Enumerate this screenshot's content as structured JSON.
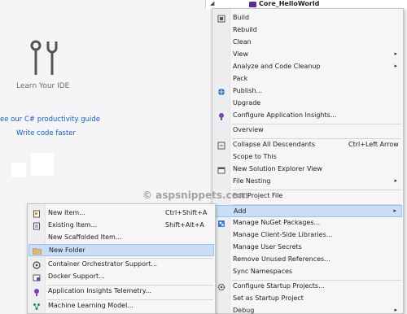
{
  "start_page": {
    "learn_label": "Learn Your IDE",
    "productivity_link": "ee our C# productivity guide",
    "write_faster_link": "Write code faster"
  },
  "solution_explorer": {
    "root_arrow": "◢",
    "root_label": "Core_HelloWorld"
  },
  "context_menu": {
    "items": [
      {
        "label": "Build",
        "icon": "build-icon"
      },
      {
        "label": "Rebuild"
      },
      {
        "label": "Clean"
      },
      {
        "label": "View",
        "arrow": "▸"
      },
      {
        "label": "Analyze and Code Cleanup",
        "arrow": "▸"
      },
      {
        "label": "Pack"
      },
      {
        "label": "Publish...",
        "icon": "globe-icon"
      },
      {
        "label": "Upgrade"
      },
      {
        "label": "Configure Application Insights...",
        "icon": "insights-icon"
      },
      {
        "label": "Overview"
      },
      {
        "label": "Collapse All Descendants",
        "shortcut": "Ctrl+Left Arrow",
        "icon": "collapse-icon"
      },
      {
        "label": "Scope to This"
      },
      {
        "label": "New Solution Explorer View",
        "icon": "new-view-icon"
      },
      {
        "label": "File Nesting",
        "arrow": "▸"
      },
      {
        "label": "Edit Project File"
      },
      {
        "label": "Add",
        "arrow": "▸"
      },
      {
        "label": "Manage NuGet Packages...",
        "icon": "nuget-icon"
      },
      {
        "label": "Manage Client-Side Libraries..."
      },
      {
        "label": "Manage User Secrets"
      },
      {
        "label": "Remove Unused References..."
      },
      {
        "label": "Sync Namespaces"
      },
      {
        "label": "Configure Startup Projects...",
        "icon": "gear-icon"
      },
      {
        "label": "Set as Startup Project"
      },
      {
        "label": "Debug",
        "arrow": "▸"
      }
    ]
  },
  "add_submenu": {
    "items": [
      {
        "label": "New Item...",
        "shortcut": "Ctrl+Shift+A",
        "icon": "new-item-icon"
      },
      {
        "label": "Existing Item...",
        "shortcut": "Shift+Alt+A",
        "icon": "existing-item-icon"
      },
      {
        "label": "New Scaffolded Item..."
      },
      {
        "label": "New Folder",
        "icon": "folder-icon"
      },
      {
        "label": "Container Orchestrator Support...",
        "icon": "container-icon"
      },
      {
        "label": "Docker Support...",
        "icon": "docker-icon"
      },
      {
        "label": "Application Insights Telemetry...",
        "icon": "insights-icon"
      },
      {
        "label": "Machine Learning Model...",
        "icon": "ml-icon"
      }
    ]
  },
  "watermark": "© aspsnippets.com",
  "colors": {
    "highlight": "#c9def5",
    "highlight_border": "#99c4ef",
    "link": "#1a5fb4",
    "project_icon": "#5c2d91"
  }
}
